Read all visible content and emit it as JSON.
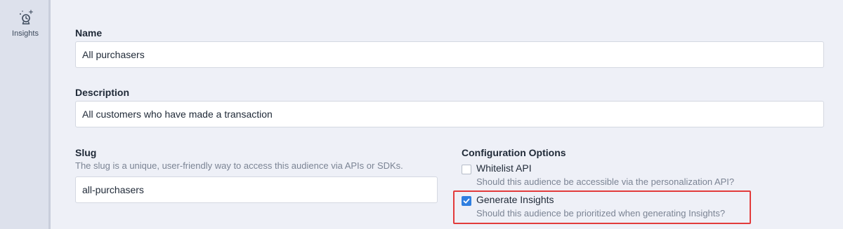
{
  "sidebar": {
    "items": [
      {
        "label": "Insights",
        "icon": "insights-icon"
      }
    ]
  },
  "form": {
    "name": {
      "label": "Name",
      "value": "All purchasers"
    },
    "description": {
      "label": "Description",
      "value": "All customers who have made a transaction"
    },
    "slug": {
      "label": "Slug",
      "hint": "The slug is a unique, user-friendly way to access this audience via APIs or SDKs.",
      "value": "all-purchasers"
    },
    "config": {
      "label": "Configuration Options",
      "options": [
        {
          "title": "Whitelist API",
          "description": "Should this audience be accessible via the personalization API?",
          "checked": false
        },
        {
          "title": "Generate Insights",
          "description": "Should this audience be prioritized when generating Insights?",
          "checked": true
        }
      ]
    }
  },
  "colors": {
    "accent": "#2f7fe0",
    "highlight": "#e23b3b",
    "background": "#eef0f7",
    "sidebar": "#dde1ec"
  }
}
